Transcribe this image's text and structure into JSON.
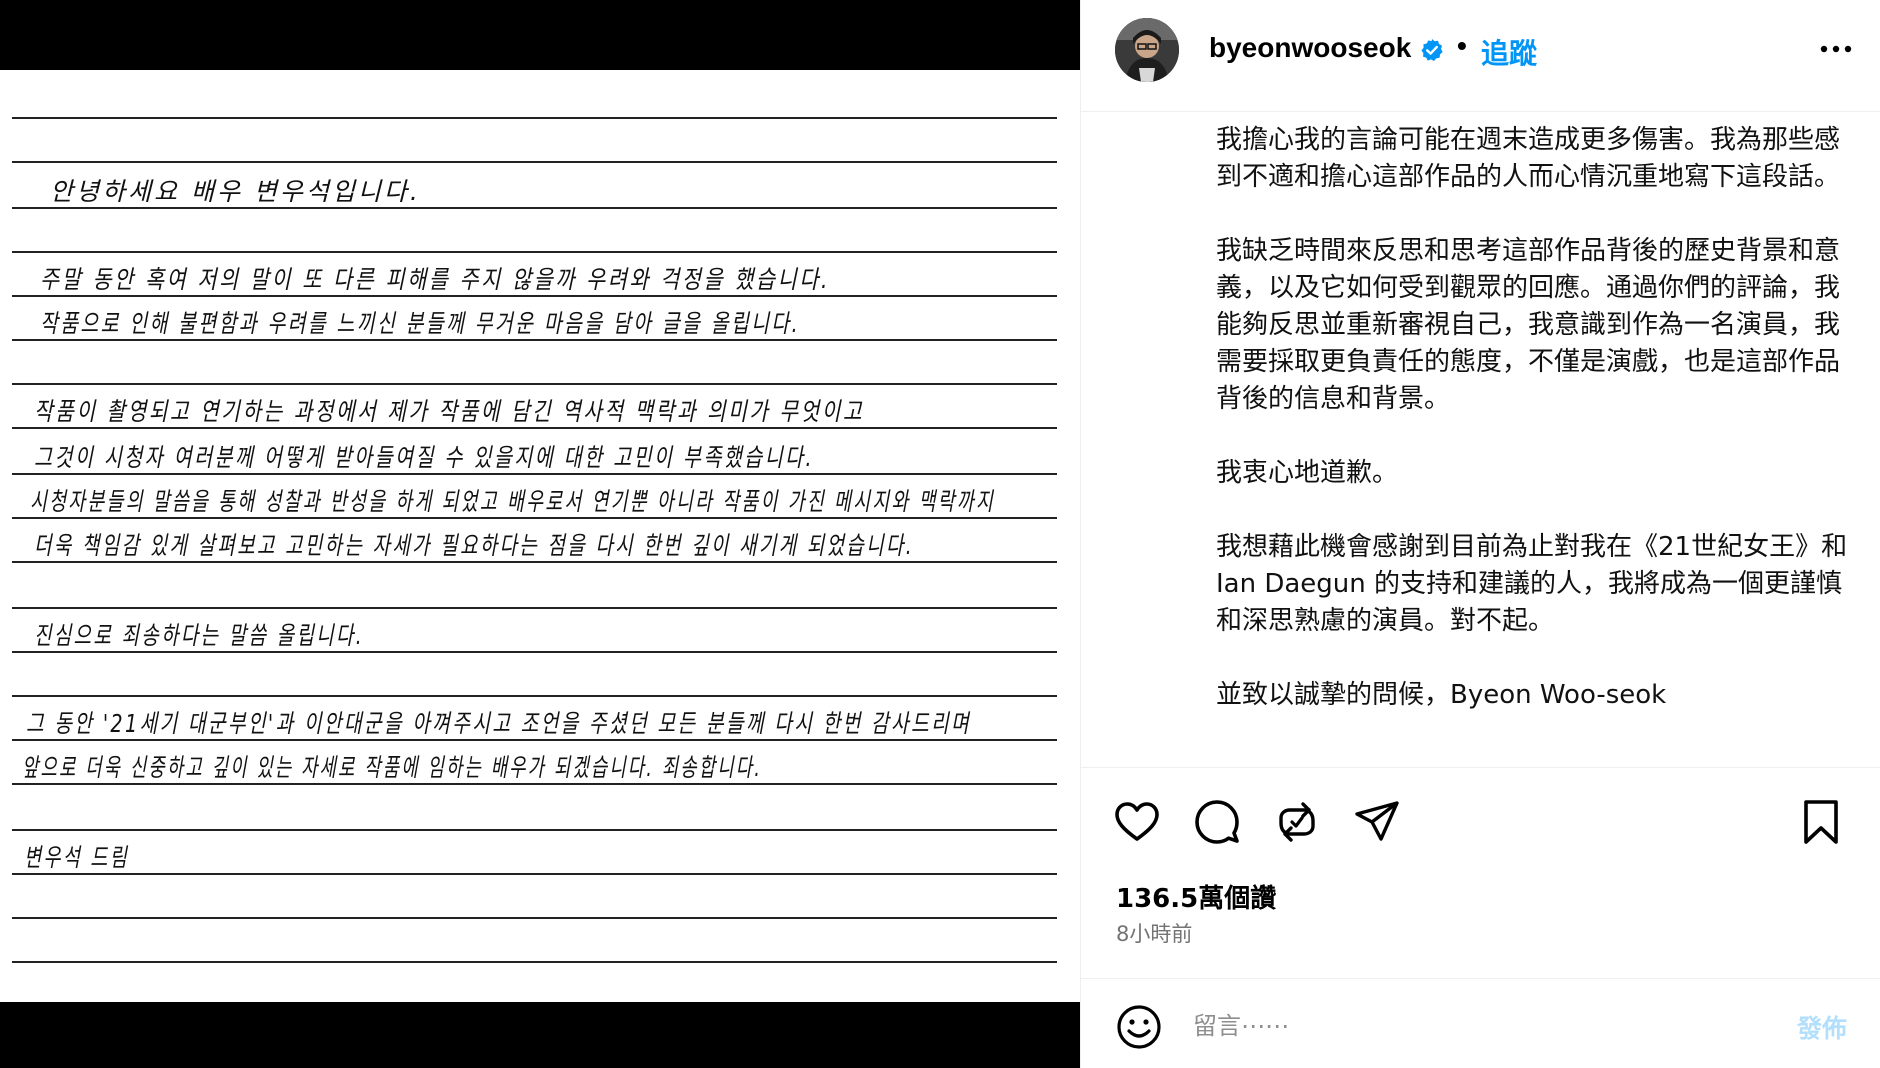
{
  "post": {
    "username": "byeonwooseok",
    "separator": "•",
    "follow_label": "追蹤",
    "verified_icon": "verified-badge-icon",
    "more_icon": "more-options-icon"
  },
  "letter": {
    "lines": [
      "안녕하세요 배우 변우석입니다.",
      "주말 동안 혹여 저의 말이 또 다른 피해를 주지 않을까 우려와 걱정을 했습니다.",
      "작품으로 인해 불편함과 우려를 느끼신 분들께 무거운 마음을 담아 글을 올립니다.",
      "작품이 촬영되고 연기하는 과정에서 제가 작품에 담긴 역사적 맥락과 의미가 무엇이고",
      "그것이 시청자 여러분께 어떻게 받아들여질 수 있을지에 대한 고민이 부족했습니다.",
      "시청자분들의 말씀을 통해 성찰과 반성을 하게 되었고 배우로서 연기뿐 아니라 작품이 가진 메시지와 맥락까지",
      "더욱 책임감 있게 살펴보고 고민하는 자세가 필요하다는 점을 다시 한번 깊이 새기게 되었습니다.",
      "진심으로 죄송하다는 말씀 올립니다.",
      "그 동안 '21세기 대군부인'과 이안대군을 아껴주시고 조언을 주셨던 모든 분들께 다시 한번 감사드리며",
      "앞으로 더욱 신중하고 깊이 있는 자세로 작품에 임하는 배우가 되겠습니다. 죄송합니다.",
      "변우석 드림"
    ]
  },
  "caption": {
    "paragraphs": [
      "我擔心我的言論可能在週末造成更多傷害。我為那些感到不適和擔心這部作品的人而心情沉重地寫下這段話。",
      "我缺乏時間來反思和思考這部作品背後的歷史背景和意義，以及它如何受到觀眾的回應。通過你們的評論，我能夠反思並重新審視自己，我意識到作為一名演員，我需要採取更負責任的態度，不僅是演戲，也是這部作品背後的信息和背景。",
      "我衷心地道歉。",
      "我想藉此機會感謝到目前為止對我在《21世紀女王》和 Ian Daegun 的支持和建議的人，我將成為一個更謹慎和深思熟慮的演員。對不起。",
      "並致以誠摯的問候，Byeon Woo-seok"
    ]
  },
  "actions": {
    "icons": [
      "heart-icon",
      "comment-icon",
      "repost-icon",
      "share-icon",
      "bookmark-icon"
    ]
  },
  "stats": {
    "likes": "136.5萬個讚",
    "time": "8小時前"
  },
  "comment": {
    "placeholder": "留言⋯⋯",
    "post_label": "發佈",
    "emoji_icon": "emoji-icon"
  },
  "colors": {
    "link_blue": "#0095f6",
    "post_disabled": "#b2dffc",
    "muted": "#737373"
  }
}
